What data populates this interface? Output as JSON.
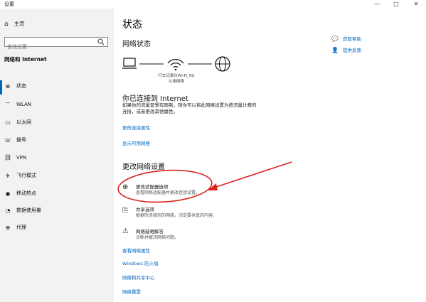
{
  "window": {
    "title": "设置",
    "minimize": "—",
    "maximize": "□",
    "close": "✕"
  },
  "sidebar": {
    "home": "主页",
    "search_placeholder": "查找设置",
    "section": "网络和 Internet",
    "items": [
      {
        "label": "状态",
        "icon": "globe-icon"
      },
      {
        "label": "WLAN",
        "icon": "wifi-icon"
      },
      {
        "label": "以太网",
        "icon": "ethernet-icon"
      },
      {
        "label": "拨号",
        "icon": "dialup-icon"
      },
      {
        "label": "VPN",
        "icon": "vpn-icon"
      },
      {
        "label": "飞行模式",
        "icon": "airplane-icon"
      },
      {
        "label": "移动热点",
        "icon": "hotspot-icon"
      },
      {
        "label": "数据使用量",
        "icon": "data-usage-icon"
      },
      {
        "label": "代理",
        "icon": "proxy-icon"
      }
    ]
  },
  "main": {
    "title": "状态",
    "network_status_heading": "网络状态",
    "network_name": "行车记录仪Wi-Fi_5G",
    "network_type": "公用网络",
    "connected_heading": "你已连接到 Internet",
    "connected_desc_1": "如果你的流量套餐有限制，则你可以将此网络设置为按流量计费的",
    "connected_desc_2": "连接，或者更改其他属性。",
    "link_change_connection": "更改连接属性",
    "link_show_networks": "显示可用网络",
    "change_settings_heading": "更改网络设置",
    "options": [
      {
        "title": "更改适配器选项",
        "desc": "查看网络适配器并更改连接设置。"
      },
      {
        "title": "共享选项",
        "desc": "根据所连接到的网络，决定要共享的内容。"
      },
      {
        "title": "网络疑难解答",
        "desc": "诊断并解决网络问题。"
      }
    ],
    "link_view_properties": "查看网络属性",
    "link_firewall": "Windows 防火墙",
    "link_sharing_center": "网络和共享中心",
    "link_reset": "网络重置"
  },
  "help": {
    "get_help": "获取帮助",
    "feedback": "提供反馈"
  },
  "colors": {
    "accent": "#0067c0",
    "annotation": "#d9241c",
    "sidebar_bg": "#f2f2f2"
  }
}
